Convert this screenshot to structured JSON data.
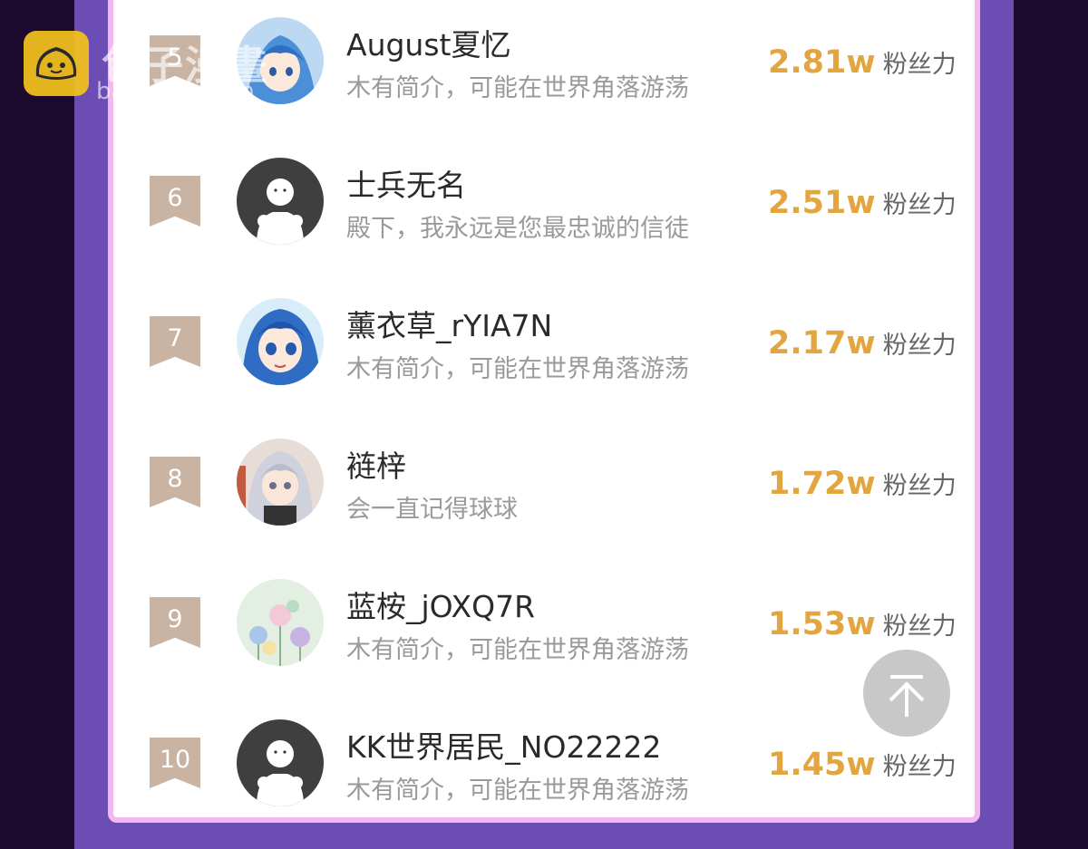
{
  "watermark": {
    "brand": "包子漫畫",
    "url": "baozimh.com"
  },
  "ranking": [
    {
      "rank": "5",
      "name": "August夏忆",
      "bio": "木有简介，可能在世界角落游荡",
      "fans": "2.81w",
      "fans_label": "粉丝力",
      "avatar": "anime-blue-avatar"
    },
    {
      "rank": "6",
      "name": "士兵无名",
      "bio": "殿下，我永远是您最忠诚的信徒",
      "fans": "2.51w",
      "fans_label": "粉丝力",
      "avatar": "default-avatar"
    },
    {
      "rank": "7",
      "name": "薰衣草_rYIA7N",
      "bio": "木有简介，可能在世界角落游荡",
      "fans": "2.17w",
      "fans_label": "粉丝力",
      "avatar": "anime-blue-hair-avatar"
    },
    {
      "rank": "8",
      "name": "裢梓",
      "bio": "会一直记得球球",
      "fans": "1.72w",
      "fans_label": "粉丝力",
      "avatar": "anime-silver-hair-avatar"
    },
    {
      "rank": "9",
      "name": "蓝桉_jOXQ7R",
      "bio": "木有简介，可能在世界角落游荡",
      "fans": "1.53w",
      "fans_label": "粉丝力",
      "avatar": "flower-painting-avatar"
    },
    {
      "rank": "10",
      "name": "KK世界居民_NO22222",
      "bio": "木有简介，可能在世界角落游荡",
      "fans": "1.45w",
      "fans_label": "粉丝力",
      "avatar": "default-avatar"
    }
  ],
  "colors": {
    "accent": "#e2a540",
    "band": "#6b4db3",
    "card_border": "#f3b8ee",
    "rank_badge": "#c9b3a2"
  },
  "scroll_top_icon": "arrow-up-icon"
}
